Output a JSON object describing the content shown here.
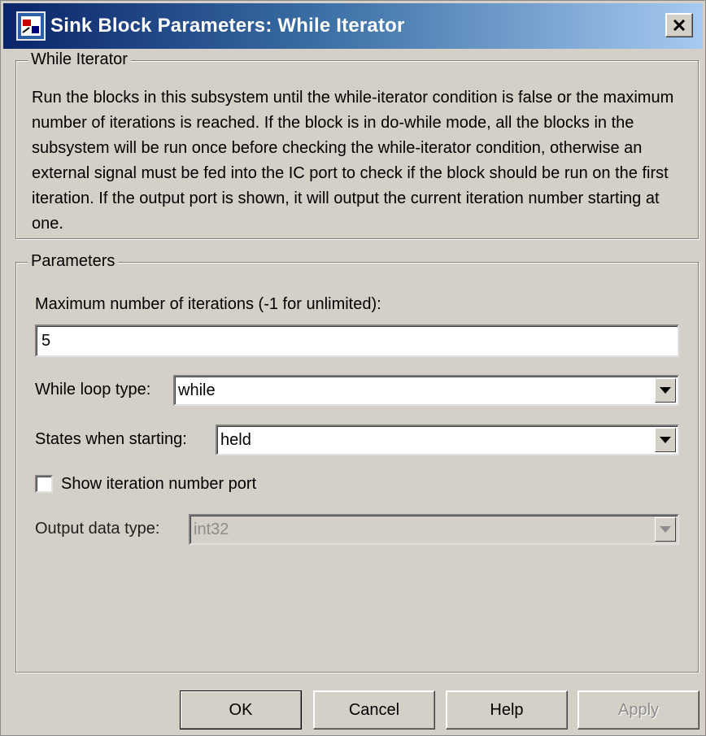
{
  "window": {
    "title": "Sink Block Parameters: While Iterator"
  },
  "block_group": {
    "title": "While Iterator",
    "description": "Run the blocks in this subsystem until the while-iterator condition is false or the maximum number of iterations is reached.  If the block is in do-while mode, all the blocks in the subsystem will be run once before checking the while-iterator condition, otherwise an external signal must be fed into the IC port to check if the block should be run on the first iteration. If the output port is shown, it will output the current iteration number starting at one."
  },
  "parameters": {
    "title": "Parameters",
    "max_iterations_label": "Maximum number of iterations (-1 for unlimited):",
    "max_iterations_value": "5",
    "loop_type_label": "While loop type:",
    "loop_type_value": "while",
    "states_label": "States when starting:",
    "states_value": "held",
    "show_port_label": "Show iteration number port",
    "show_port_checked": false,
    "output_type_label": "Output data type:",
    "output_type_value": "int32"
  },
  "buttons": {
    "ok": "OK",
    "cancel": "Cancel",
    "help": "Help",
    "apply": "Apply"
  },
  "icons": {
    "app": "simulink-block-icon",
    "close": "close-icon",
    "dropdown": "chevron-down-icon"
  },
  "colors": {
    "titlebar_start": "#0a246a",
    "titlebar_end": "#a6caf0",
    "dialog_bg": "#d4d0c8"
  }
}
